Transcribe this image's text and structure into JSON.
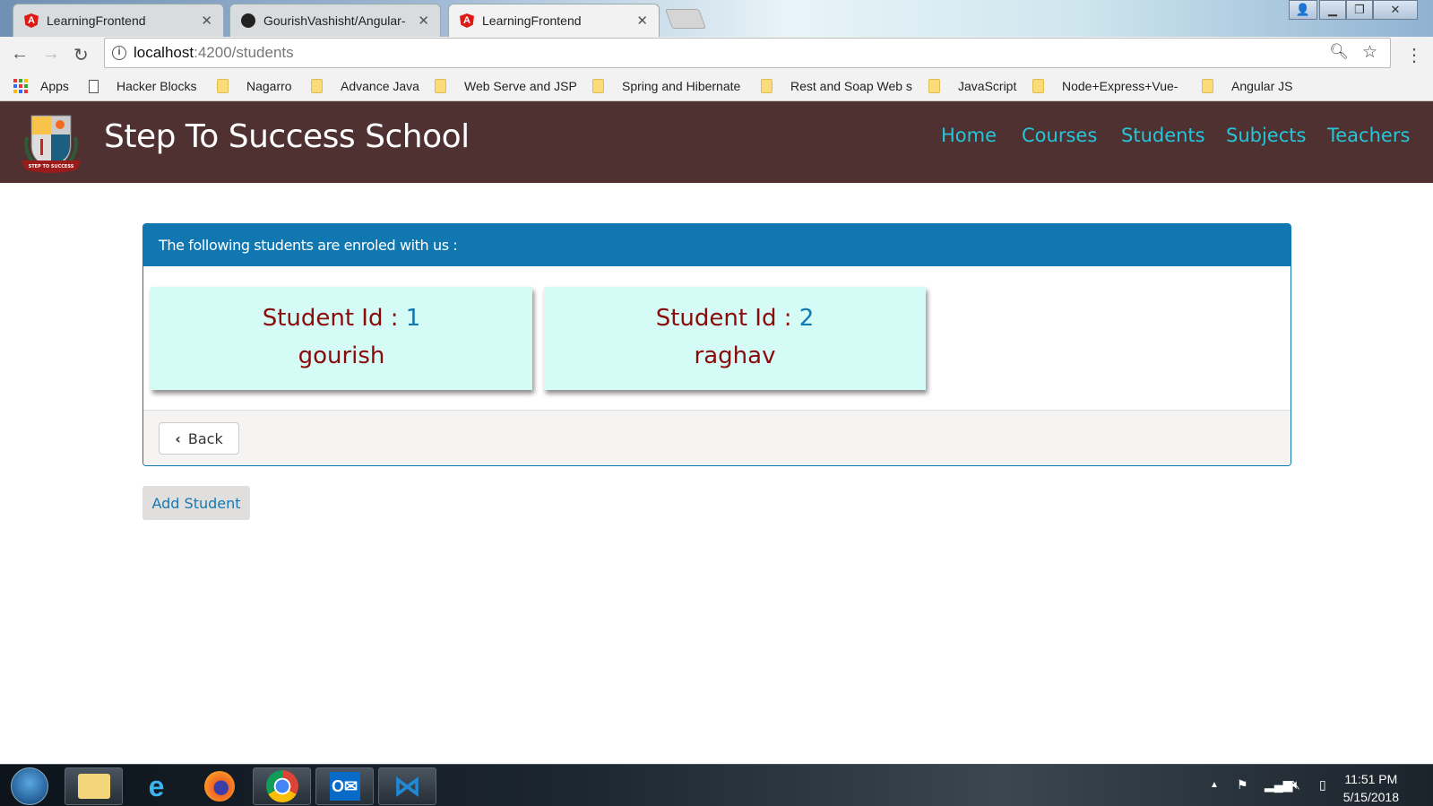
{
  "browser": {
    "tabs": [
      {
        "title": "LearningFrontend",
        "icon": "angular-icon"
      },
      {
        "title": "GourishVashisht/Angular-",
        "icon": "github-icon"
      },
      {
        "title": "LearningFrontend",
        "icon": "angular-icon",
        "active": true
      }
    ],
    "url_host": "localhost",
    "url_path": ":4200/students",
    "bookmarks": [
      "Apps",
      "Hacker Blocks",
      "Nagarro",
      "Advance Java",
      "Web Serve and JSP",
      "Spring and Hibernate",
      "Rest and Soap Web s",
      "JavaScript",
      "Node+Express+Vue-",
      "Angular JS"
    ]
  },
  "header": {
    "brand": "Step To Success School",
    "logo_text": "STEP TO SUCCESS SCHOOL",
    "nav": [
      "Home",
      "Courses",
      "Students",
      "Subjects",
      "Teachers"
    ],
    "nav_color": "#26c6da",
    "bg": "#4e3130"
  },
  "panel": {
    "heading": "The following students are enroled with us :",
    "id_label": "Student Id : ",
    "students": [
      {
        "id": "1",
        "name": "gourish"
      },
      {
        "id": "2",
        "name": "raghav"
      }
    ],
    "back_label": "Back"
  },
  "add_label": "Add Student",
  "taskbar": {
    "time": "11:51 PM",
    "date": "5/15/2018"
  }
}
